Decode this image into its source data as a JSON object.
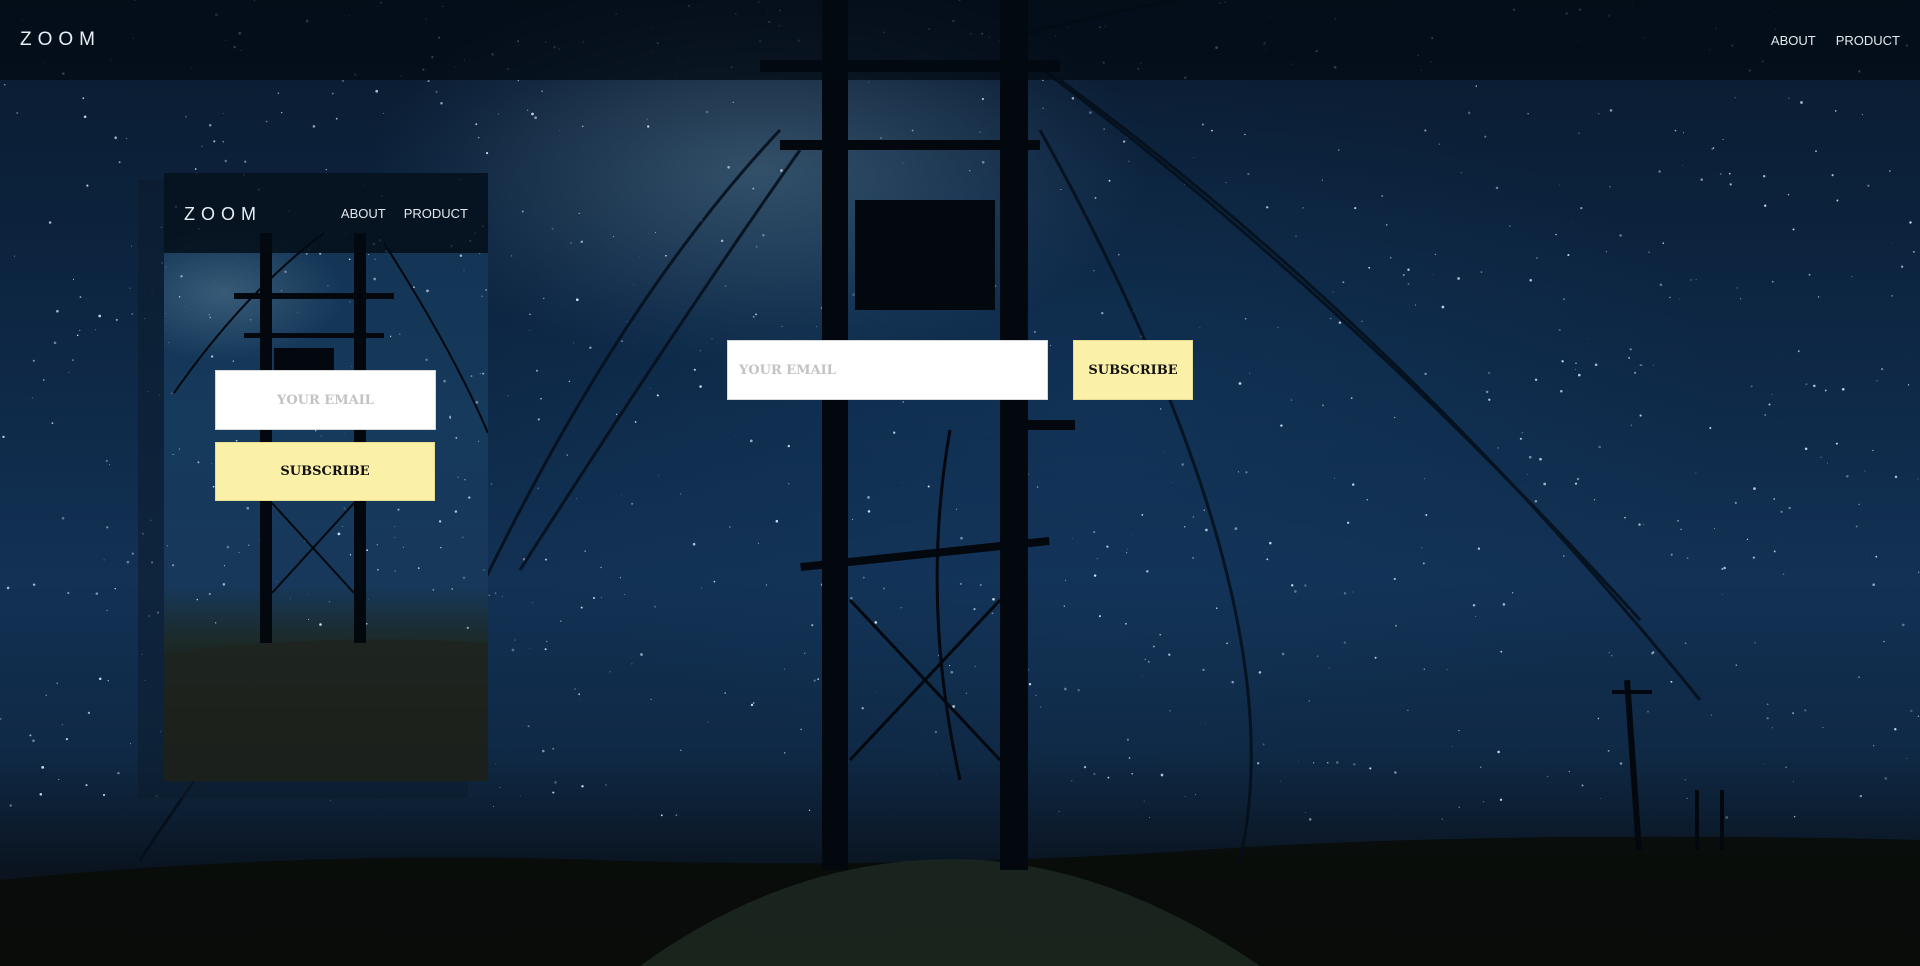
{
  "header": {
    "logo": "ZOOM",
    "nav": [
      "ABOUT",
      "PRODUCT"
    ]
  },
  "subscribe": {
    "email_placeholder": "YOUR EMAIL",
    "button_label": "SUBSCRIBE"
  },
  "mobile_preview": {
    "logo": "ZOOM",
    "nav": [
      "ABOUT",
      "PRODUCT"
    ],
    "email_placeholder": "YOUR EMAIL",
    "button_label": "SUBSCRIBE"
  },
  "colors": {
    "accent_button": "#fbf0a8",
    "nav_background": "#030a12",
    "sky": "#0d2744"
  },
  "background": {
    "icon": "night-sky-power-lines-photo"
  }
}
